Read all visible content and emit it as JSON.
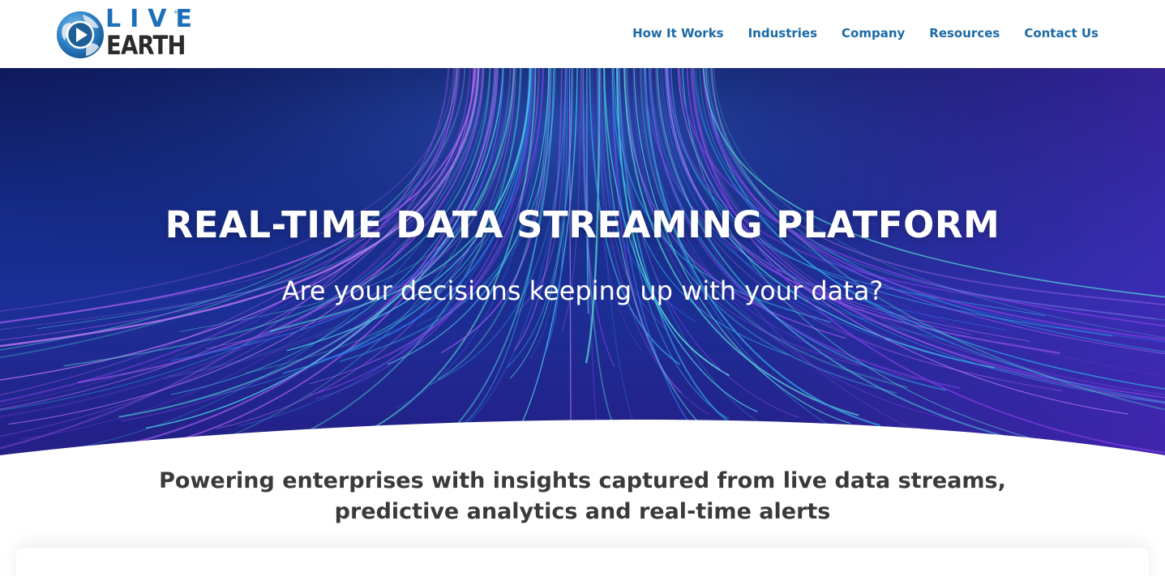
{
  "logo": {
    "word_top": "LIVE",
    "word_bottom": "EARTH",
    "trademark": "®",
    "icon": "globe-play-icon",
    "colors": {
      "blue": "#1c6fb8",
      "dark": "#2b2b2b"
    }
  },
  "nav": {
    "items": [
      {
        "label": "How It Works"
      },
      {
        "label": "Industries"
      },
      {
        "label": "Company"
      },
      {
        "label": "Resources"
      },
      {
        "label": "Contact Us"
      }
    ],
    "color": "#1c6aa6"
  },
  "hero": {
    "title": "REAL-TIME DATA STREAMING PLATFORM",
    "subtitle": "Are your decisions keeping up with your data?",
    "background_colors": [
      "#0e1a5c",
      "#1c2f98",
      "#7b3fe0",
      "#33a3e0"
    ]
  },
  "tagline": {
    "line1": "Powering enterprises with insights captured from live data streams,",
    "line2": "predictive analytics and real-time alerts"
  }
}
